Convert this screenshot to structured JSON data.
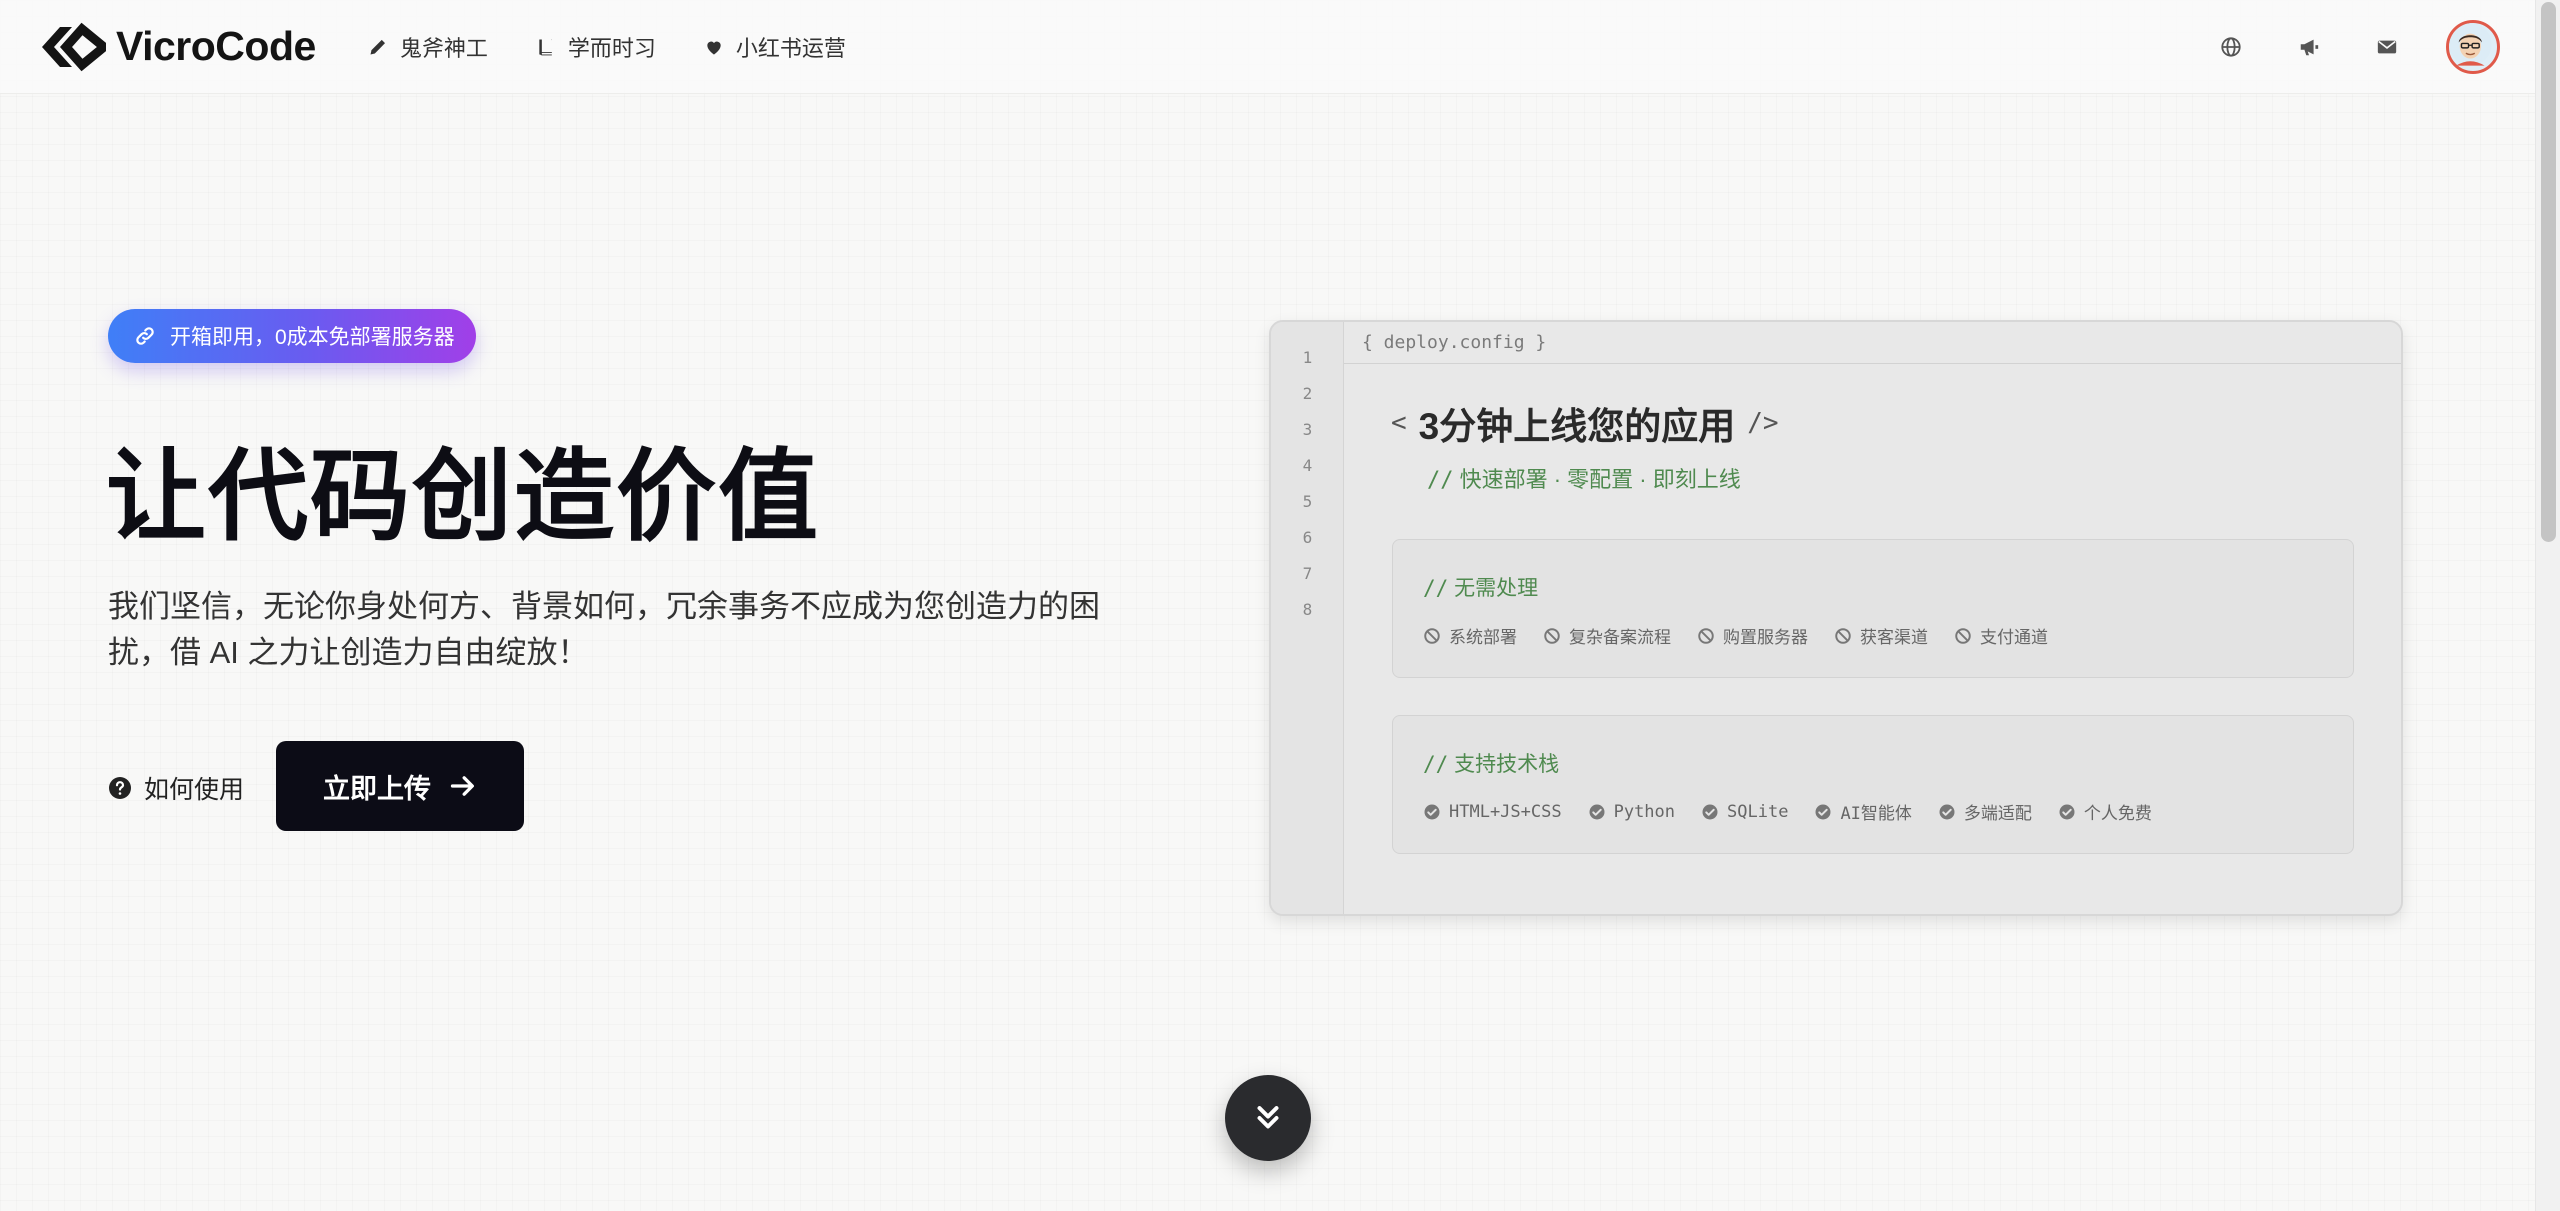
{
  "header": {
    "logo_text": "VicroCode",
    "nav": [
      {
        "label": "鬼斧神工",
        "icon": "pencil-icon"
      },
      {
        "label": "学而时习",
        "icon": "book-icon"
      },
      {
        "label": "小红书运营",
        "icon": "heart-icon"
      }
    ],
    "right_icons": [
      "globe-icon",
      "megaphone-icon",
      "mail-icon",
      "avatar"
    ]
  },
  "hero": {
    "badge": "开箱即用，0成本免部署服务器",
    "title": "让代码创造价值",
    "description": "我们坚信，无论你身处何方、背景如何，冗余事务不应成为您创造力的困扰，借 AI 之力让创造力自由绽放！",
    "howto_label": "如何使用",
    "upload_label": "立即上传"
  },
  "code_card": {
    "file_tab": "{ deploy.config }",
    "line_numbers": [
      "1",
      "2",
      "3",
      "4",
      "5",
      "6",
      "7",
      "8"
    ],
    "tag_open": "<",
    "title": "3分钟上线您的应用",
    "tag_close": "/>",
    "comment_prefix": "//",
    "subtitle": "快速部署 · 零配置 · 即刻上线",
    "blocks": [
      {
        "title": "无需处理",
        "icon": "ban-icon",
        "items": [
          "系统部署",
          "复杂备案流程",
          "购置服务器",
          "获客渠道",
          "支付通道"
        ]
      },
      {
        "title": "支持技术栈",
        "icon": "check-circle-icon",
        "items": [
          "HTML+JS+CSS",
          "Python",
          "SQLite",
          "AI智能体",
          "多端适配",
          "个人免费"
        ]
      }
    ]
  },
  "colors": {
    "badge_gradient_start": "#3f7ff7",
    "badge_gradient_end": "#a13fe8",
    "primary_button": "#0c0c16",
    "comment_green": "#4f8a4f",
    "avatar_border": "#e05a4a"
  }
}
